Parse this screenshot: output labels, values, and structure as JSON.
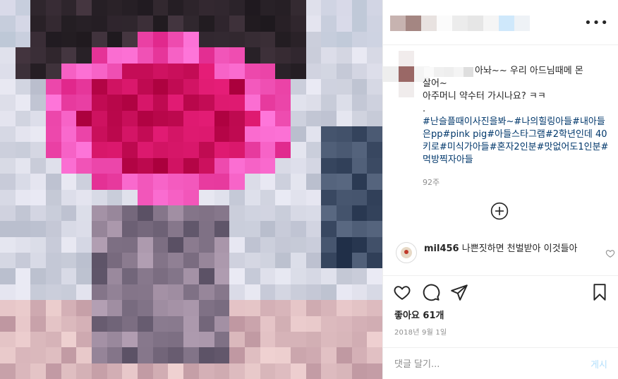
{
  "header": {
    "more_icon": "ellipsis-icon",
    "more_label": "•••"
  },
  "caption": {
    "line1": "아놔~~ 우리 아드님때메 몬",
    "line2": "살어~",
    "line3": "아주머니 약수터 가시나요? ㅋㅋ",
    "line4": ".",
    "tags": "#난슬플때이사진을봐~#나의힐링아들#내아들은pp#pink pig#아들스타그램#2학년인데 40키로#미식가아들#혼자2인분#맛없어도1인분#먹방찍자아들",
    "time": "92주"
  },
  "comments": [
    {
      "username": "mil456",
      "text": "나쁜짓하면 천벌받아 이것들아"
    }
  ],
  "actions": {
    "like_icon": "heart-icon",
    "comment_icon": "comment-icon",
    "share_icon": "send-icon",
    "save_icon": "bookmark-icon"
  },
  "likes": "좋아요 61개",
  "date": "2018년 9월 1일",
  "comment_bar": {
    "placeholder": "댓글 달기...",
    "post_label": "게시"
  }
}
